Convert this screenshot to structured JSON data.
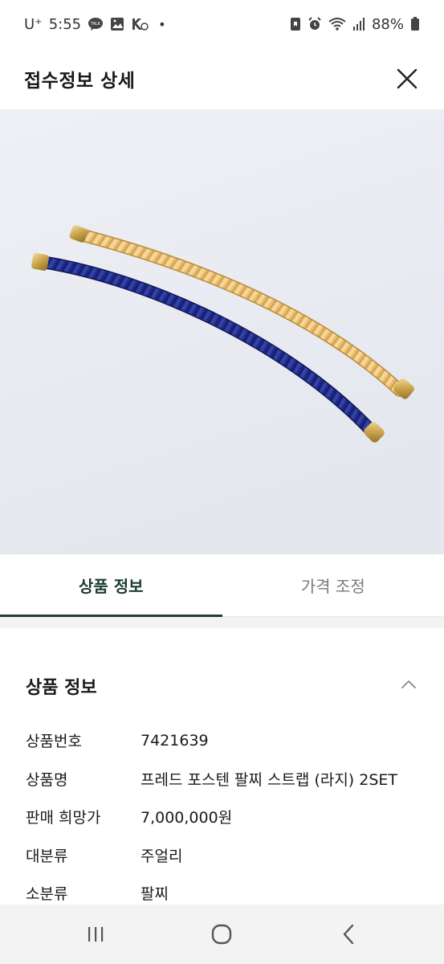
{
  "status_bar": {
    "carrier": "U⁺",
    "time": "5:55",
    "dot": "•",
    "battery": "88%",
    "icons_left": [
      "talk-notification-icon",
      "gallery-icon",
      "network-speed-icon"
    ],
    "icons_right": [
      "save-icon",
      "alarm-icon",
      "wifi-icon",
      "signal-icon",
      "battery-icon"
    ]
  },
  "header": {
    "title": "접수정보 상세"
  },
  "tabs": [
    {
      "label": "상품 정보",
      "active": true
    },
    {
      "label": "가격 조정",
      "active": false
    }
  ],
  "section": {
    "title": "상품 정보",
    "rows": [
      {
        "label": "상품번호",
        "value": "7421639"
      },
      {
        "label": "상품명",
        "value": "프레드 포스텐 팔찌 스트랩 (라지) 2SET"
      },
      {
        "label": "판매 희망가",
        "value": "7,000,000원"
      },
      {
        "label": "대분류",
        "value": "주얼리"
      },
      {
        "label": "소분류",
        "value": "팔찌"
      }
    ]
  },
  "colors": {
    "accent": "#1f3d30",
    "navy_cord": "#1f2a8a",
    "gold_cord": "#e8b96a",
    "gold_cap": "#c9a24a"
  }
}
